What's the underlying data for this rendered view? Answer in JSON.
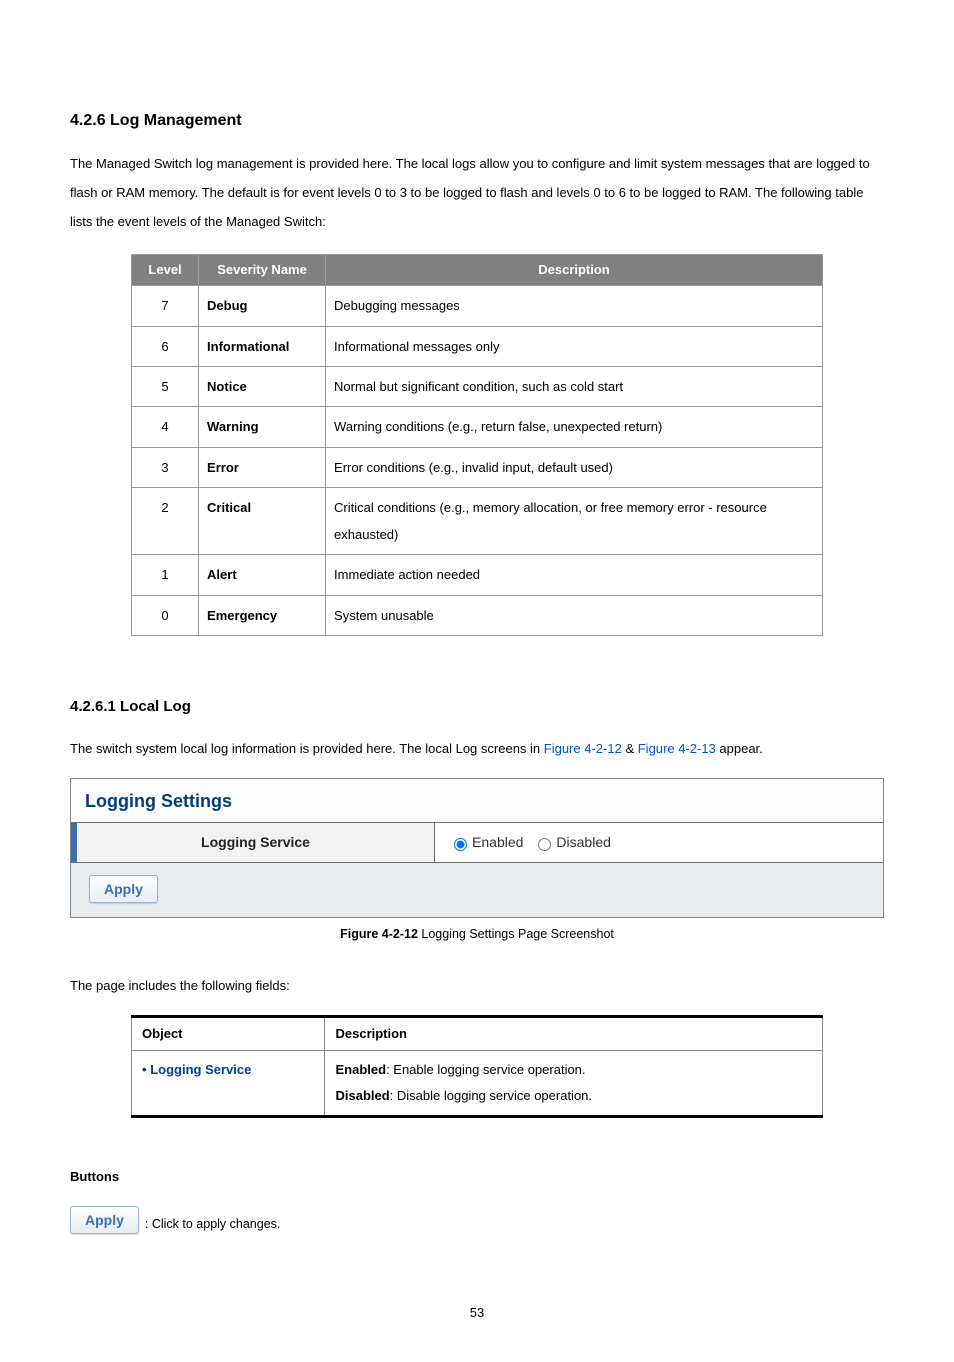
{
  "section": {
    "heading": "4.2.6 Log Management",
    "intro": "The Managed Switch log management is provided here. The local logs allow you to configure and limit system messages that are logged to flash or RAM memory. The default is for event levels 0 to 3 to be logged to flash and levels 0 to 6 to be logged to RAM. The following table lists the event levels of the Managed Switch:"
  },
  "severity_table": {
    "headers": {
      "level": "Level",
      "name": "Severity Name",
      "desc": "Description"
    },
    "rows": [
      {
        "level": "7",
        "name": "Debug",
        "desc": "Debugging messages"
      },
      {
        "level": "6",
        "name": "Informational",
        "desc": "Informational messages only"
      },
      {
        "level": "5",
        "name": "Notice",
        "desc": "Normal but significant condition, such as cold start"
      },
      {
        "level": "4",
        "name": "Warning",
        "desc": "Warning conditions (e.g., return false, unexpected return)"
      },
      {
        "level": "3",
        "name": "Error",
        "desc": "Error conditions (e.g., invalid input, default used)"
      },
      {
        "level": "2",
        "name": "Critical",
        "desc": "Critical conditions (e.g., memory allocation, or free memory error - resource exhausted)"
      },
      {
        "level": "1",
        "name": "Alert",
        "desc": "Immediate action needed"
      },
      {
        "level": "0",
        "name": "Emergency",
        "desc": "System unusable"
      }
    ]
  },
  "subsection": {
    "heading": "4.2.6.1 Local Log",
    "intro_pre": "The switch system local log information is provided here. The local Log screens in ",
    "link1": "Figure 4-2-12",
    "amp": " & ",
    "link2": "Figure 4-2-13",
    "intro_post": " appear."
  },
  "panel": {
    "title": "Logging Settings",
    "row_label": "Logging Service",
    "enabled": "Enabled",
    "disabled": "Disabled",
    "apply": "Apply"
  },
  "caption": {
    "bold": "Figure 4-2-12",
    "rest": " Logging Settings Page Screenshot"
  },
  "fields_intro": "The page includes the following fields:",
  "obj_table": {
    "headers": {
      "object": "Object",
      "desc": "Description"
    },
    "row": {
      "object": "Logging Service",
      "enabled_b": "Enabled",
      "enabled_rest": ": Enable logging service operation.",
      "disabled_b": "Disabled",
      "disabled_rest": ": Disable logging service operation."
    }
  },
  "buttons": {
    "heading": "Buttons",
    "apply": "Apply",
    "desc": ": Click to apply changes."
  },
  "page_number": "53"
}
